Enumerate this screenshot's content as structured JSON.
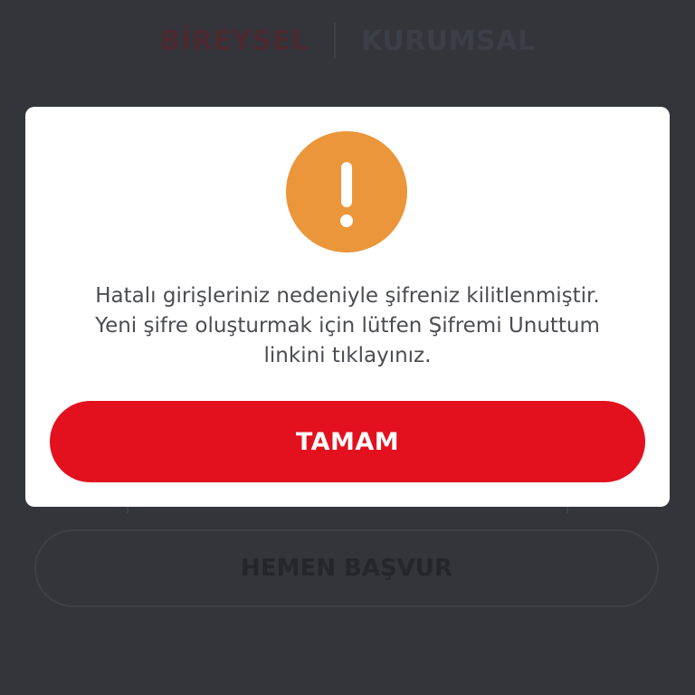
{
  "background": {
    "tabs": [
      {
        "label": "BİREYSEL",
        "active": true
      },
      {
        "label": "KURUMSAL",
        "active": false
      }
    ],
    "apply_button_label": "HEMEN BAŞVUR"
  },
  "dialog": {
    "icon": "exclamation-icon",
    "icon_color": "#eb963a",
    "message_lines": [
      "Hatalı girişleriniz nedeniyle şifreniz kilitlenmiştir.",
      "Yeni şifre oluşturmak için lütfen Şifremi Unuttum",
      "linkini tıklayınız."
    ],
    "confirm_label": "TAMAM",
    "confirm_color": "#e3101e"
  }
}
